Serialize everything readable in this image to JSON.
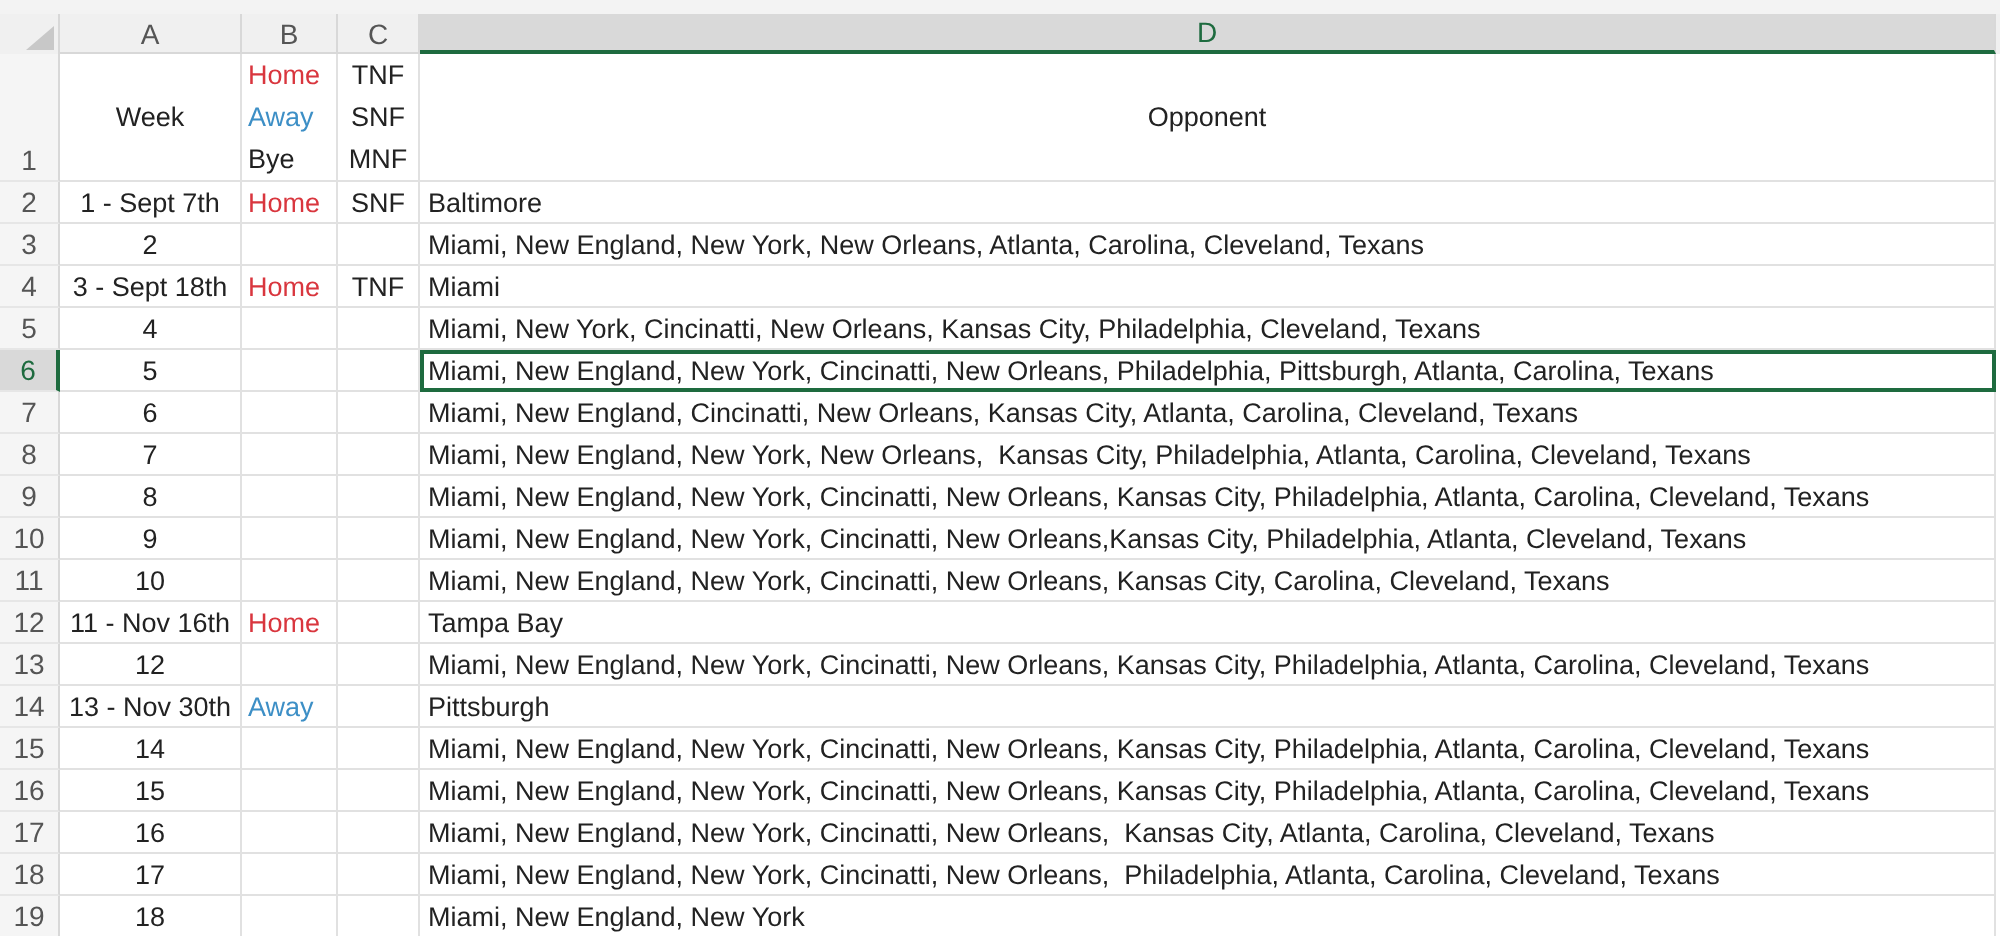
{
  "column_headers": [
    {
      "label": "A",
      "selected": false
    },
    {
      "label": "B",
      "selected": false
    },
    {
      "label": "C",
      "selected": false
    },
    {
      "label": "D",
      "selected": true
    }
  ],
  "header_row": {
    "number": "1",
    "week": "Week",
    "venue_legend": [
      {
        "text": "Home",
        "kind": "home"
      },
      {
        "text": "Away",
        "kind": "away"
      },
      {
        "text": "Bye",
        "kind": "bye"
      }
    ],
    "broadcast_legend": [
      "TNF",
      "SNF",
      "MNF"
    ],
    "opponent": "Opponent"
  },
  "rows": [
    {
      "number": "2",
      "week": "1 - Sept 7th",
      "venue": {
        "text": "Home",
        "kind": "home"
      },
      "broadcast": "SNF",
      "opponent": "Baltimore",
      "selected": false
    },
    {
      "number": "3",
      "week": "2",
      "opponent": "Miami, New England, New York, New Orleans, Atlanta, Carolina, Cleveland, Texans",
      "selected": false
    },
    {
      "number": "4",
      "week": "3 - Sept 18th",
      "venue": {
        "text": "Home",
        "kind": "home"
      },
      "broadcast": "TNF",
      "opponent": "Miami",
      "selected": false
    },
    {
      "number": "5",
      "week": "4",
      "opponent": "Miami, New York, Cincinatti, New Orleans, Kansas City, Philadelphia, Cleveland, Texans",
      "selected": false
    },
    {
      "number": "6",
      "week": "5",
      "opponent": "Miami, New England, New York, Cincinatti, New Orleans, Philadelphia, Pittsburgh, Atlanta, Carolina, Texans",
      "selected": true
    },
    {
      "number": "7",
      "week": "6",
      "opponent": "Miami, New England, Cincinatti, New Orleans, Kansas City, Atlanta, Carolina, Cleveland, Texans",
      "selected": false
    },
    {
      "number": "8",
      "week": "7",
      "opponent": "Miami, New England, New York, New Orleans,  Kansas City, Philadelphia, Atlanta, Carolina, Cleveland, Texans",
      "selected": false
    },
    {
      "number": "9",
      "week": "8",
      "opponent": "Miami, New England, New York, Cincinatti, New Orleans, Kansas City, Philadelphia, Atlanta, Carolina, Cleveland, Texans",
      "selected": false
    },
    {
      "number": "10",
      "week": "9",
      "opponent": "Miami, New England, New York, Cincinatti, New Orleans,Kansas City, Philadelphia, Atlanta, Cleveland, Texans",
      "selected": false
    },
    {
      "number": "11",
      "week": "10",
      "opponent": "Miami, New England, New York, Cincinatti, New Orleans, Kansas City, Carolina, Cleveland, Texans",
      "selected": false
    },
    {
      "number": "12",
      "week": "11 - Nov 16th",
      "venue": {
        "text": "Home",
        "kind": "home"
      },
      "opponent": "Tampa Bay",
      "selected": false
    },
    {
      "number": "13",
      "week": "12",
      "opponent": "Miami, New England, New York, Cincinatti, New Orleans, Kansas City, Philadelphia, Atlanta, Carolina, Cleveland, Texans",
      "selected": false
    },
    {
      "number": "14",
      "week": "13 - Nov 30th",
      "venue": {
        "text": "Away",
        "kind": "away"
      },
      "opponent": "Pittsburgh",
      "selected": false
    },
    {
      "number": "15",
      "week": "14",
      "opponent": "Miami, New England, New York, Cincinatti, New Orleans, Kansas City, Philadelphia, Atlanta, Carolina, Cleveland, Texans",
      "selected": false
    },
    {
      "number": "16",
      "week": "15",
      "opponent": "Miami, New England, New York, Cincinatti, New Orleans, Kansas City, Philadelphia, Atlanta, Carolina, Cleveland, Texans",
      "selected": false
    },
    {
      "number": "17",
      "week": "16",
      "opponent": "Miami, New England, New York, Cincinatti, New Orleans,  Kansas City, Atlanta, Carolina, Cleveland, Texans",
      "selected": false
    },
    {
      "number": "18",
      "week": "17",
      "opponent": "Miami, New England, New York, Cincinatti, New Orleans,  Philadelphia, Atlanta, Carolina, Cleveland, Texans",
      "selected": false
    },
    {
      "number": "19",
      "week": "18",
      "opponent": "Miami, New England, New York",
      "selected": false
    }
  ]
}
